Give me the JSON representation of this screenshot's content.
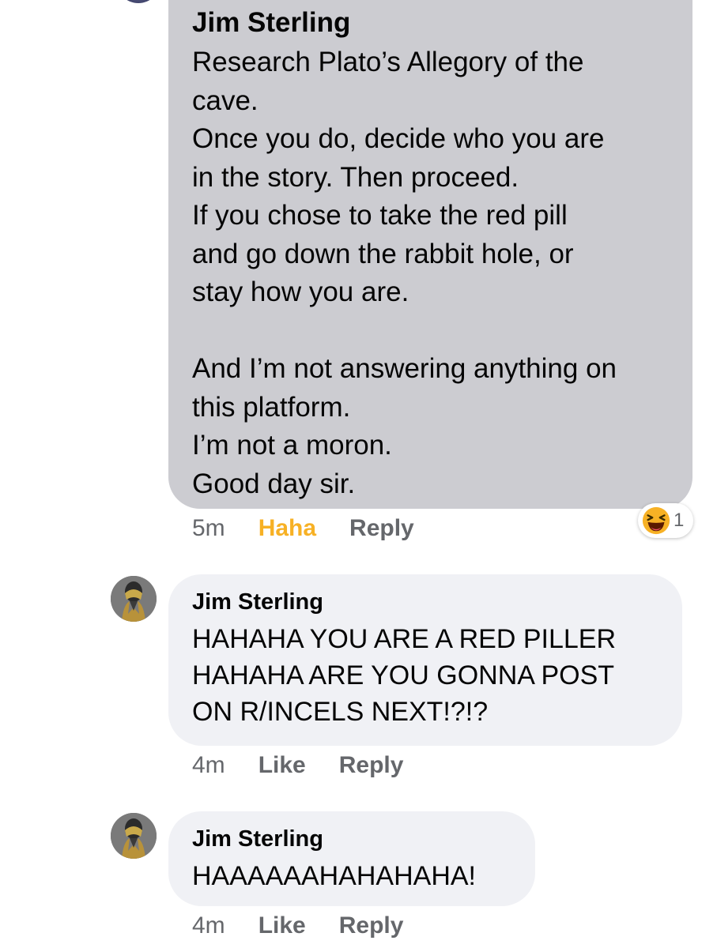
{
  "comments": [
    {
      "author": "Jim Sterling",
      "body": "Research Plato’s Allegory of the\ncave.\nOnce you do, decide who you are\nin the story. Then proceed.\nIf you chose to take the red pill\nand go down the rabbit hole, or\nstay how you are.\n\nAnd I’m not answering anything on\nthis platform.\nI’m not a moron.\nGood day sir.",
      "time": "5m",
      "reaction_label": "Haha",
      "reply_label": "Reply",
      "reaction_count": "1",
      "reaction_icon": "laughing-emoji-icon",
      "reaction_color": "#f7b125"
    },
    {
      "author": "Jim Sterling",
      "body": "HAHAHA YOU ARE A RED PILLER\nHAHAHA ARE YOU GONNA POST\nON R/INCELS NEXT!?!?",
      "time": "4m",
      "reaction_label": "Like",
      "reply_label": "Reply"
    },
    {
      "author": "Jim Sterling",
      "body": "HAAAAAAHAHAHAHA!",
      "time": "4m",
      "reaction_label": "Like",
      "reply_label": "Reply"
    }
  ],
  "colors": {
    "bubble_main": "#ccccd1",
    "bubble_reply": "#f0f1f5",
    "meta_text": "#65676b",
    "haha_active": "#f7b125"
  }
}
